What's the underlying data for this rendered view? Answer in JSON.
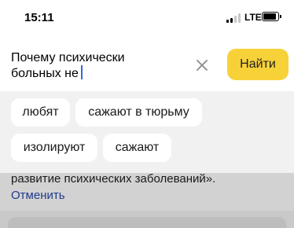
{
  "status_bar": {
    "time": "15:11",
    "network": "LTE"
  },
  "search": {
    "query_line1": "Почему психически",
    "query_line2": "больных не",
    "clear_icon": "close-icon",
    "find_label": "Найти"
  },
  "suggestions": [
    "любят",
    "сажают в тюрьму",
    "изолируют",
    "сажают"
  ],
  "background": {
    "text": "развитие психических заболеваний».",
    "link": "Отменить"
  },
  "colors": {
    "accent": "#f7d138",
    "link": "#1f3b8a",
    "caret": "#2c6bdc"
  }
}
